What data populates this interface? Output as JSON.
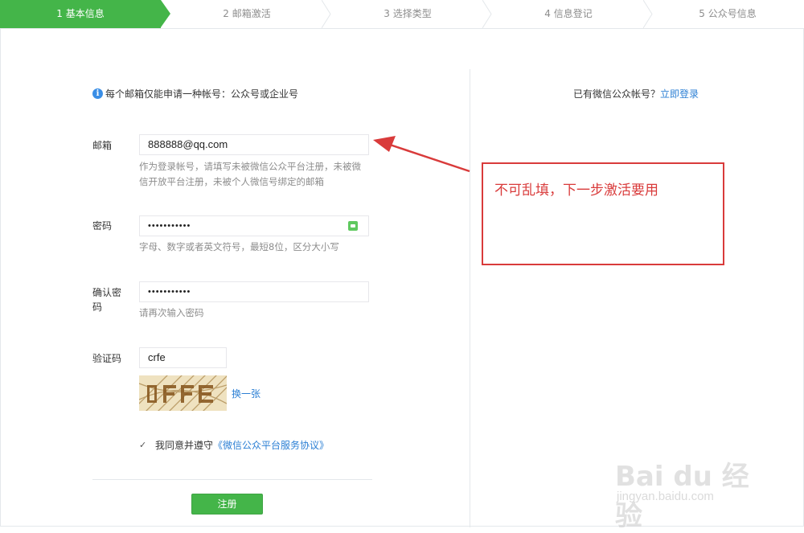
{
  "steps": [
    {
      "label": "1 基本信息",
      "active": true
    },
    {
      "label": "2 邮箱激活",
      "active": false
    },
    {
      "label": "3 选择类型",
      "active": false
    },
    {
      "label": "4 信息登记",
      "active": false
    },
    {
      "label": "5 公众号信息",
      "active": false
    }
  ],
  "form": {
    "tip": "每个邮箱仅能申请一种帐号：公众号或企业号",
    "email": {
      "label": "邮箱",
      "value": "888888@qq.com",
      "hint": "作为登录帐号，请填写未被微信公众平台注册，未被微信开放平台注册，未被个人微信号绑定的邮箱"
    },
    "password": {
      "label": "密码",
      "value": "•••••••••••",
      "hint": "字母、数字或者英文符号，最短8位，区分大小写"
    },
    "confirm": {
      "label": "确认密码",
      "value": "•••••••••••",
      "hint": "请再次输入密码"
    },
    "captcha": {
      "label": "验证码",
      "value": "crfe",
      "swap_label": "换一张"
    },
    "agree": {
      "prefix": "我同意并遵守",
      "link": "《微信公众平台服务协议》",
      "checked": true
    },
    "register_label": "注册"
  },
  "side": {
    "prefix": "已有微信公众帐号？",
    "login_link": "立即登录"
  },
  "annotation": {
    "text": "不可乱填，下一步激活要用",
    "color": "#d93b3b"
  },
  "watermark": {
    "main": "Bai du 经验",
    "sub": "jingyan.baidu.com"
  },
  "colors": {
    "accent": "#44b549",
    "link": "#2b7fd4"
  }
}
